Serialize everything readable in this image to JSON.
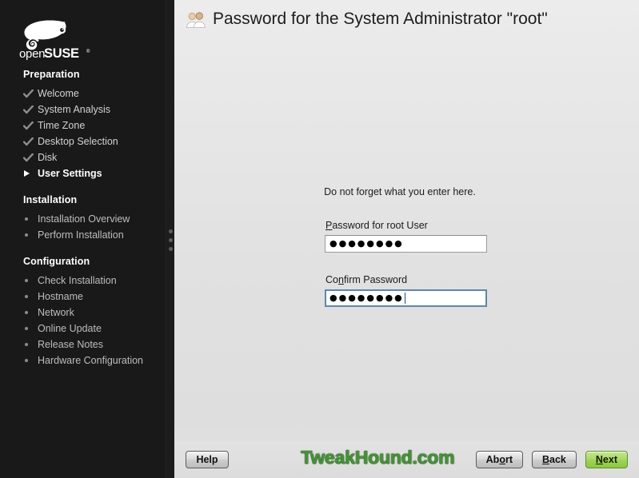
{
  "window": {
    "title": "Password for the System Administrator \"root\""
  },
  "colors": {
    "sidebar_bg": "#191919",
    "main_bg": "#e2e2e2",
    "accent_green": "#8cc93f",
    "watermark_green": "#3a9a28",
    "focus_blue": "#5a87b5"
  },
  "sidebar": {
    "logo_name": "openSUSE",
    "logo_word_open": "open",
    "logo_word_suse": "SUSE",
    "groups": [
      {
        "heading": "Preparation",
        "items": [
          {
            "label": "Welcome",
            "state": "done"
          },
          {
            "label": "System Analysis",
            "state": "done"
          },
          {
            "label": "Time Zone",
            "state": "done"
          },
          {
            "label": "Desktop Selection",
            "state": "done"
          },
          {
            "label": "Disk",
            "state": "done"
          },
          {
            "label": "User Settings",
            "state": "current"
          }
        ]
      },
      {
        "heading": "Installation",
        "items": [
          {
            "label": "Installation Overview",
            "state": "pending"
          },
          {
            "label": "Perform Installation",
            "state": "pending"
          }
        ]
      },
      {
        "heading": "Configuration",
        "items": [
          {
            "label": "Check Installation",
            "state": "pending"
          },
          {
            "label": "Hostname",
            "state": "pending"
          },
          {
            "label": "Network",
            "state": "pending"
          },
          {
            "label": "Online Update",
            "state": "pending"
          },
          {
            "label": "Release Notes",
            "state": "pending"
          },
          {
            "label": "Hardware Configuration",
            "state": "pending"
          }
        ]
      }
    ]
  },
  "header": {
    "icon": "users-icon",
    "title": "Password for the System Administrator \"root\""
  },
  "main": {
    "hint": "Do not forget what you enter here.",
    "fields": [
      {
        "label_before": "P",
        "label_mnemonic": "",
        "label": "Password for root User",
        "mnemonic": "P",
        "value_masked": "●●●●●●●●",
        "char_count": "8",
        "focused": "false"
      },
      {
        "label": "Confirm Password",
        "mnemonic": "n",
        "value_masked": "●●●●●●●●",
        "char_count": "8",
        "focused": "true"
      }
    ]
  },
  "footer": {
    "help_label": "Help",
    "abort_label": "Abort",
    "back_label": "Back",
    "next_label": "Next",
    "watermark": "TweakHound.com"
  }
}
